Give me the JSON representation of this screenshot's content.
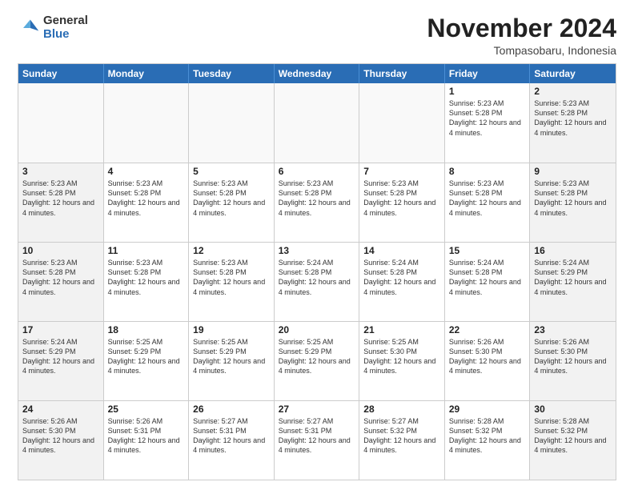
{
  "logo": {
    "general": "General",
    "blue": "Blue"
  },
  "title": "November 2024",
  "location": "Tompasobaru, Indonesia",
  "header": {
    "days": [
      "Sunday",
      "Monday",
      "Tuesday",
      "Wednesday",
      "Thursday",
      "Friday",
      "Saturday"
    ]
  },
  "weeks": [
    [
      {
        "day": "",
        "info": "",
        "empty": true
      },
      {
        "day": "",
        "info": "",
        "empty": true
      },
      {
        "day": "",
        "info": "",
        "empty": true
      },
      {
        "day": "",
        "info": "",
        "empty": true
      },
      {
        "day": "",
        "info": "",
        "empty": true
      },
      {
        "day": "1",
        "info": "Sunrise: 5:23 AM\nSunset: 5:28 PM\nDaylight: 12 hours and 4 minutes.",
        "empty": false
      },
      {
        "day": "2",
        "info": "Sunrise: 5:23 AM\nSunset: 5:28 PM\nDaylight: 12 hours and 4 minutes.",
        "empty": false
      }
    ],
    [
      {
        "day": "3",
        "info": "Sunrise: 5:23 AM\nSunset: 5:28 PM\nDaylight: 12 hours and 4 minutes.",
        "empty": false
      },
      {
        "day": "4",
        "info": "Sunrise: 5:23 AM\nSunset: 5:28 PM\nDaylight: 12 hours and 4 minutes.",
        "empty": false
      },
      {
        "day": "5",
        "info": "Sunrise: 5:23 AM\nSunset: 5:28 PM\nDaylight: 12 hours and 4 minutes.",
        "empty": false
      },
      {
        "day": "6",
        "info": "Sunrise: 5:23 AM\nSunset: 5:28 PM\nDaylight: 12 hours and 4 minutes.",
        "empty": false
      },
      {
        "day": "7",
        "info": "Sunrise: 5:23 AM\nSunset: 5:28 PM\nDaylight: 12 hours and 4 minutes.",
        "empty": false
      },
      {
        "day": "8",
        "info": "Sunrise: 5:23 AM\nSunset: 5:28 PM\nDaylight: 12 hours and 4 minutes.",
        "empty": false
      },
      {
        "day": "9",
        "info": "Sunrise: 5:23 AM\nSunset: 5:28 PM\nDaylight: 12 hours and 4 minutes.",
        "empty": false
      }
    ],
    [
      {
        "day": "10",
        "info": "Sunrise: 5:23 AM\nSunset: 5:28 PM\nDaylight: 12 hours and 4 minutes.",
        "empty": false
      },
      {
        "day": "11",
        "info": "Sunrise: 5:23 AM\nSunset: 5:28 PM\nDaylight: 12 hours and 4 minutes.",
        "empty": false
      },
      {
        "day": "12",
        "info": "Sunrise: 5:23 AM\nSunset: 5:28 PM\nDaylight: 12 hours and 4 minutes.",
        "empty": false
      },
      {
        "day": "13",
        "info": "Sunrise: 5:24 AM\nSunset: 5:28 PM\nDaylight: 12 hours and 4 minutes.",
        "empty": false
      },
      {
        "day": "14",
        "info": "Sunrise: 5:24 AM\nSunset: 5:28 PM\nDaylight: 12 hours and 4 minutes.",
        "empty": false
      },
      {
        "day": "15",
        "info": "Sunrise: 5:24 AM\nSunset: 5:28 PM\nDaylight: 12 hours and 4 minutes.",
        "empty": false
      },
      {
        "day": "16",
        "info": "Sunrise: 5:24 AM\nSunset: 5:29 PM\nDaylight: 12 hours and 4 minutes.",
        "empty": false
      }
    ],
    [
      {
        "day": "17",
        "info": "Sunrise: 5:24 AM\nSunset: 5:29 PM\nDaylight: 12 hours and 4 minutes.",
        "empty": false
      },
      {
        "day": "18",
        "info": "Sunrise: 5:25 AM\nSunset: 5:29 PM\nDaylight: 12 hours and 4 minutes.",
        "empty": false
      },
      {
        "day": "19",
        "info": "Sunrise: 5:25 AM\nSunset: 5:29 PM\nDaylight: 12 hours and 4 minutes.",
        "empty": false
      },
      {
        "day": "20",
        "info": "Sunrise: 5:25 AM\nSunset: 5:29 PM\nDaylight: 12 hours and 4 minutes.",
        "empty": false
      },
      {
        "day": "21",
        "info": "Sunrise: 5:25 AM\nSunset: 5:30 PM\nDaylight: 12 hours and 4 minutes.",
        "empty": false
      },
      {
        "day": "22",
        "info": "Sunrise: 5:26 AM\nSunset: 5:30 PM\nDaylight: 12 hours and 4 minutes.",
        "empty": false
      },
      {
        "day": "23",
        "info": "Sunrise: 5:26 AM\nSunset: 5:30 PM\nDaylight: 12 hours and 4 minutes.",
        "empty": false
      }
    ],
    [
      {
        "day": "24",
        "info": "Sunrise: 5:26 AM\nSunset: 5:30 PM\nDaylight: 12 hours and 4 minutes.",
        "empty": false
      },
      {
        "day": "25",
        "info": "Sunrise: 5:26 AM\nSunset: 5:31 PM\nDaylight: 12 hours and 4 minutes.",
        "empty": false
      },
      {
        "day": "26",
        "info": "Sunrise: 5:27 AM\nSunset: 5:31 PM\nDaylight: 12 hours and 4 minutes.",
        "empty": false
      },
      {
        "day": "27",
        "info": "Sunrise: 5:27 AM\nSunset: 5:31 PM\nDaylight: 12 hours and 4 minutes.",
        "empty": false
      },
      {
        "day": "28",
        "info": "Sunrise: 5:27 AM\nSunset: 5:32 PM\nDaylight: 12 hours and 4 minutes.",
        "empty": false
      },
      {
        "day": "29",
        "info": "Sunrise: 5:28 AM\nSunset: 5:32 PM\nDaylight: 12 hours and 4 minutes.",
        "empty": false
      },
      {
        "day": "30",
        "info": "Sunrise: 5:28 AM\nSunset: 5:32 PM\nDaylight: 12 hours and 4 minutes.",
        "empty": false
      }
    ]
  ]
}
